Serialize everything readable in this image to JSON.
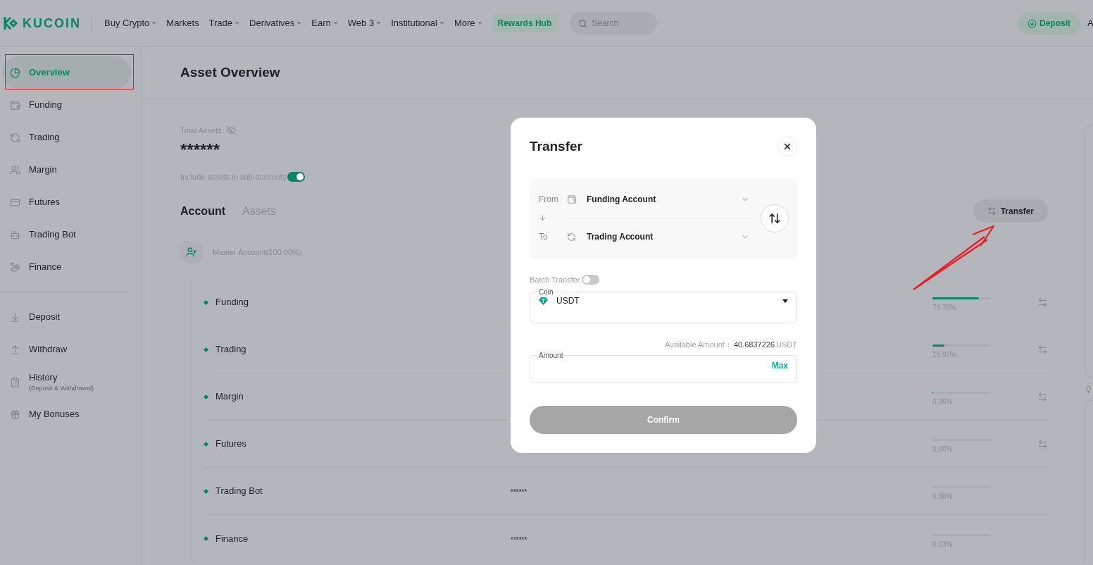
{
  "header": {
    "logo": "KUCOIN",
    "nav": [
      {
        "label": "Buy Crypto",
        "has_menu": true
      },
      {
        "label": "Markets",
        "has_menu": false
      },
      {
        "label": "Trade",
        "has_menu": true
      },
      {
        "label": "Derivatives",
        "has_menu": true
      },
      {
        "label": "Earn",
        "has_menu": true
      },
      {
        "label": "Web 3",
        "has_menu": true
      },
      {
        "label": "Institutional",
        "has_menu": true
      },
      {
        "label": "More",
        "has_menu": true
      }
    ],
    "rewards": "Rewards Hub",
    "search": {
      "placeholder": "Search"
    },
    "deposit": "Deposit",
    "cut_text": "A"
  },
  "sidebar": {
    "items": [
      {
        "label": "Overview",
        "selected": true
      },
      {
        "label": "Funding",
        "selected": false
      },
      {
        "label": "Trading",
        "selected": false
      },
      {
        "label": "Margin",
        "selected": false
      },
      {
        "label": "Futures",
        "selected": false
      },
      {
        "label": "Trading Bot",
        "selected": false
      },
      {
        "label": "Finance",
        "selected": false
      }
    ],
    "links": [
      {
        "label": "Deposit"
      },
      {
        "label": "Withdraw"
      },
      {
        "label": "History",
        "sub": "(Deposit & Withdrawal)"
      },
      {
        "label": "My Bonuses"
      }
    ]
  },
  "main": {
    "title": "Asset Overview",
    "total_label": "Total Assets",
    "total_value": "******",
    "include": {
      "label": "Include assets in sub-accounts",
      "on": true
    },
    "tabs": [
      {
        "label": "Account",
        "selected": true
      },
      {
        "label": "Assets",
        "selected": false
      }
    ],
    "transfer_button": "Transfer",
    "master": "Master Account(100.00%)",
    "accounts": [
      {
        "label": "Funding",
        "level": 0.7978,
        "percent": "79.78%",
        "transfer": true
      },
      {
        "label": "Trading",
        "level": 0.1992,
        "percent": "19.92%",
        "transfer": true
      },
      {
        "label": "Margin",
        "level": 0.0026,
        "percent": "0.26%",
        "transfer": true
      },
      {
        "label": "Futures",
        "level": 0,
        "percent": "0.00%",
        "transfer": true
      },
      {
        "label": "Trading Bot",
        "value": "******",
        "level": 0,
        "percent": "0.00%",
        "transfer": false
      },
      {
        "label": "Finance",
        "value": "******",
        "level": 0.0003,
        "percent": "0.03%",
        "transfer": false
      }
    ]
  },
  "dialog": {
    "title": "Transfer",
    "from_label": "From",
    "from": "Funding Account",
    "to_label": "To",
    "to": "Trading Account",
    "batch": {
      "label": "Batch Transfer",
      "on": false
    },
    "coin": {
      "label": "Coin",
      "value": "USDT"
    },
    "available_label": "Available Amount：",
    "available_value": "40.6837226",
    "available_unit": "USDT",
    "amount": {
      "label": "Amount"
    },
    "max": "Max",
    "confirm": "Confirm"
  }
}
